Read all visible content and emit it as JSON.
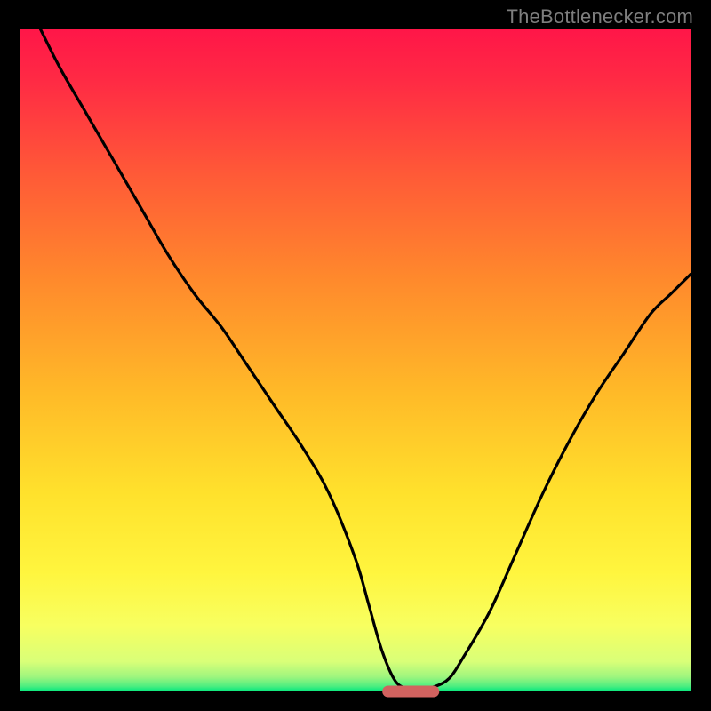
{
  "attribution": "TheBottlenecker.com",
  "chart_data": {
    "type": "line",
    "title": "",
    "xlabel": "",
    "ylabel": "",
    "xlim": [
      0,
      100
    ],
    "ylim": [
      0,
      100
    ],
    "layout": {
      "background_gradient": true,
      "gradient_top_color": "#ff1648",
      "gradient_bottom_color": "#00e77e",
      "frame_color": "#000000",
      "curve_color": "#000000",
      "marker_color": "#d1625f",
      "marker_x_range": [
        54,
        62.5
      ],
      "marker_y": 0
    },
    "series": [
      {
        "name": "bottleneck-curve",
        "x": [
          3,
          6,
          10,
          14,
          18,
          22,
          26,
          30,
          34,
          38,
          42,
          46,
          50,
          52,
          54,
          56,
          58,
          60,
          62,
          64,
          66,
          70,
          74,
          78,
          82,
          86,
          90,
          94,
          97,
          100
        ],
        "y": [
          100,
          94,
          87,
          80,
          73,
          66,
          60,
          55,
          49,
          43,
          37,
          30,
          20,
          13,
          6,
          1.5,
          0.4,
          0.4,
          0.8,
          2,
          5,
          12,
          21,
          30,
          38,
          45,
          51,
          57,
          60,
          63
        ]
      }
    ]
  }
}
